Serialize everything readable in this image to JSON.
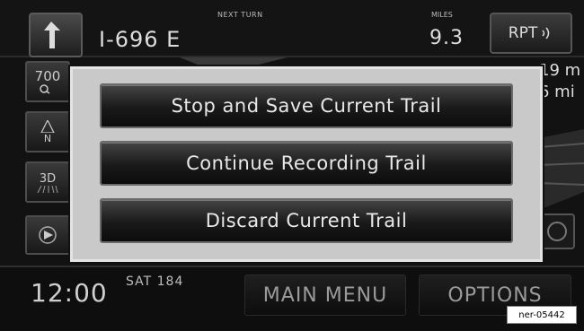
{
  "top_bar": {
    "next_turn_label": "NEXT TURN",
    "road_name": "I-696 E",
    "miles_label": "MILES",
    "miles_value": "9.3",
    "repeat_label": "RPT"
  },
  "map": {
    "zoom_label": "700",
    "heading_label": "N",
    "view_label": "3D",
    "right_distance_top": "19 m",
    "right_distance_bottom": "6 mi"
  },
  "dialog": {
    "buttons": [
      {
        "label": "Stop and Save Current Trail"
      },
      {
        "label": "Continue Recording Trail"
      },
      {
        "label": "Discard Current Trail"
      }
    ]
  },
  "bottom_bar": {
    "clock": "12:00",
    "station": "SAT 184",
    "main_menu_label": "MAIN MENU",
    "options_label": "OPTIONS"
  },
  "reference_code": "ner-05442"
}
